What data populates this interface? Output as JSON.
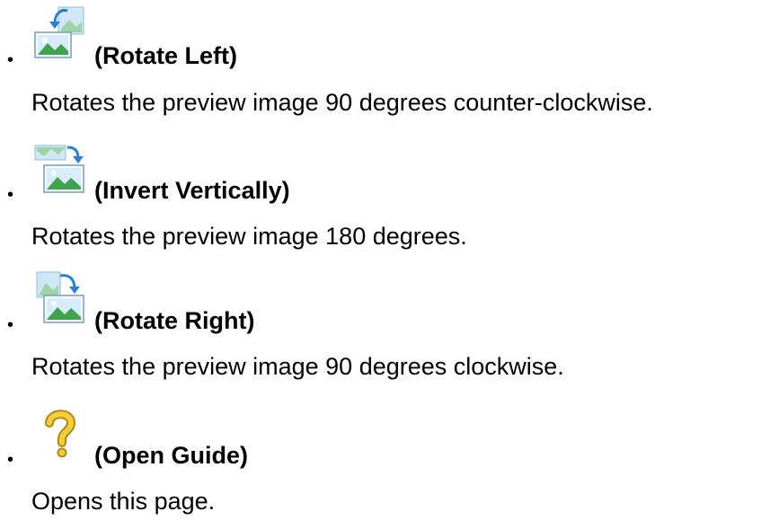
{
  "items": [
    {
      "icon": "rotate-left-icon",
      "title": "(Rotate Left)",
      "description": "Rotates the preview image 90 degrees counter-clockwise."
    },
    {
      "icon": "invert-vertically-icon",
      "title": "(Invert Vertically)",
      "description": "Rotates the preview image 180 degrees."
    },
    {
      "icon": "rotate-right-icon",
      "title": "(Rotate Right)",
      "description": "Rotates the preview image 90 degrees clockwise."
    },
    {
      "icon": "open-guide-icon",
      "title": "(Open Guide)",
      "description": "Opens this page."
    }
  ],
  "bullet": "•",
  "colors": {
    "arrow": "#2a7fd4",
    "sky": "#d8ecfb",
    "landscape_green": "#3da44a",
    "frame": "#7fb6de",
    "question_gold": "#e0b41e"
  }
}
